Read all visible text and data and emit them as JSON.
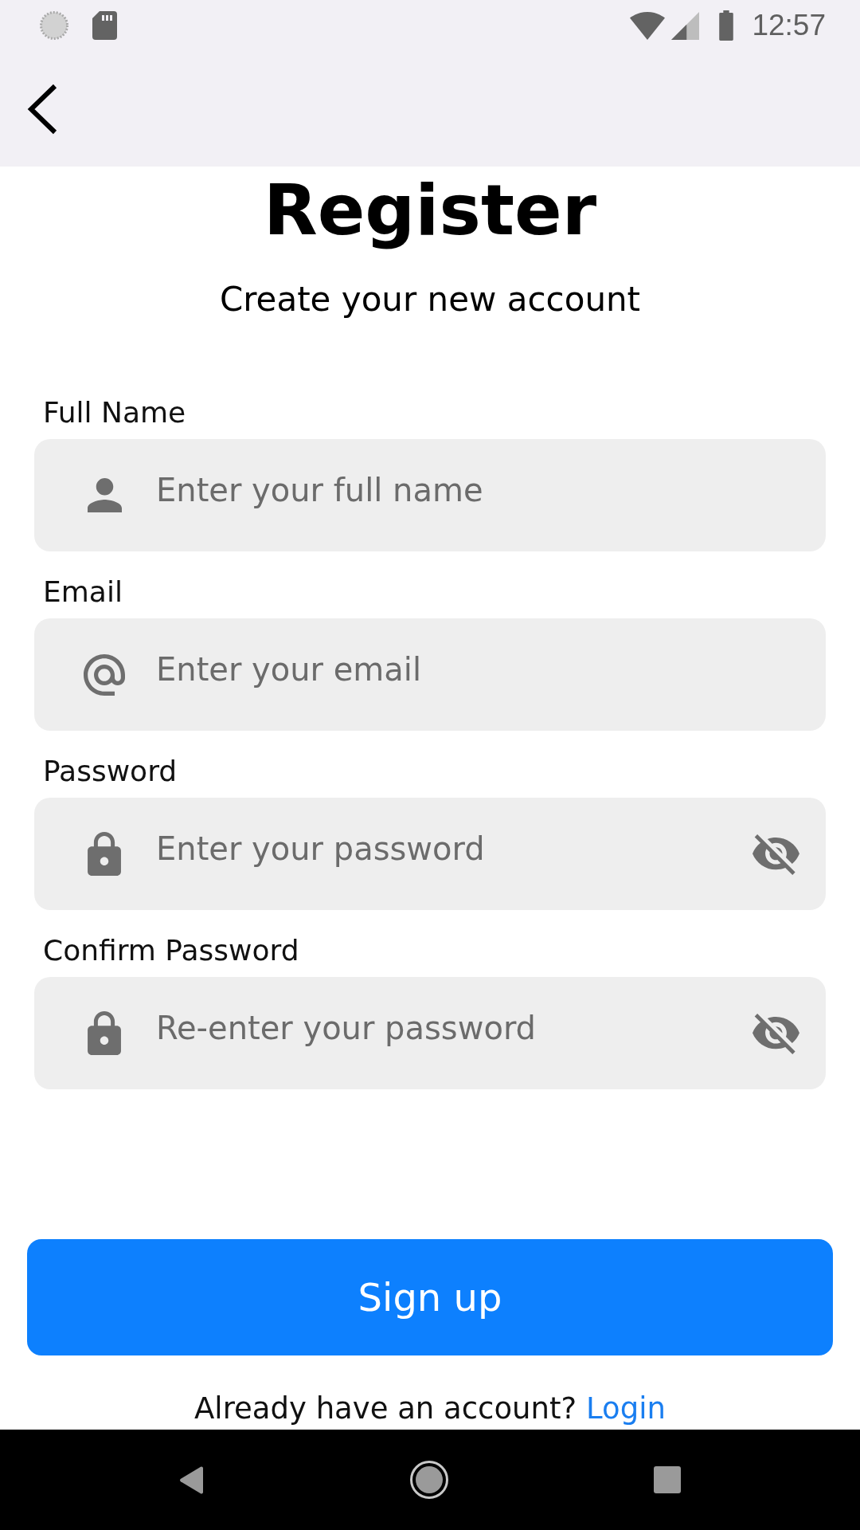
{
  "status_bar": {
    "time": "12:57"
  },
  "header": {
    "title": "Register",
    "subtitle": "Create your new account"
  },
  "fields": [
    {
      "kind": "name",
      "label": "Full Name",
      "placeholder": "Enter your full name"
    },
    {
      "kind": "email",
      "label": "Email",
      "placeholder": "Enter your email"
    },
    {
      "kind": "password",
      "label": "Password",
      "placeholder": "Enter your password",
      "revealed": false
    },
    {
      "kind": "password",
      "label": "Confirm Password",
      "placeholder": "Re-enter your password",
      "revealed": false
    }
  ],
  "submit_button": {
    "label": "Sign up"
  },
  "footer": {
    "prompt": "Already have an account?",
    "link": "Login"
  }
}
